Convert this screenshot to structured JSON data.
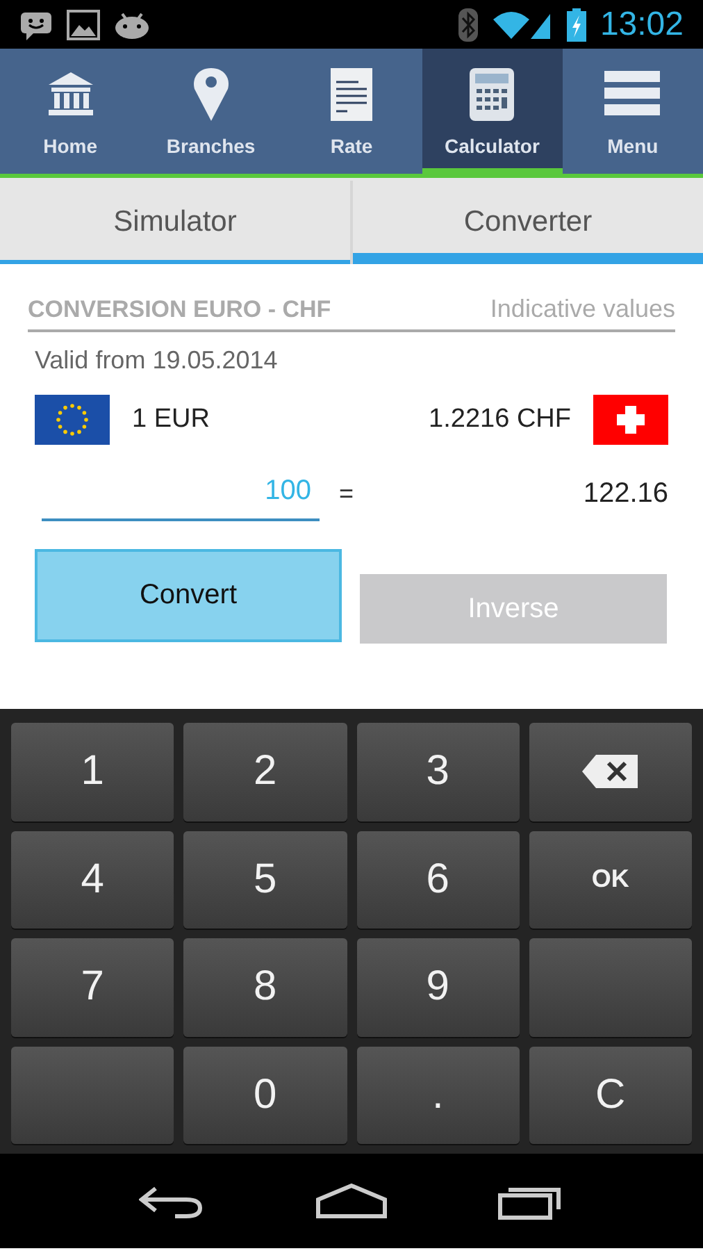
{
  "status_bar": {
    "time": "13:02"
  },
  "nav": [
    {
      "label": "Home",
      "kind": "bank",
      "selected": false
    },
    {
      "label": "Branches",
      "kind": "pin",
      "selected": false
    },
    {
      "label": "Rate",
      "kind": "note",
      "selected": false
    },
    {
      "label": "Calculator",
      "kind": "calculator",
      "selected": true
    },
    {
      "label": "Menu",
      "kind": "menu",
      "selected": false
    }
  ],
  "tabs": [
    {
      "label": "Simulator",
      "selected": false
    },
    {
      "label": "Converter",
      "selected": true
    }
  ],
  "converter": {
    "title": "CONVERSION EURO - CHF",
    "note": "Indicative values",
    "valid": "Valid from 19.05.2014",
    "from": {
      "kind": "eu",
      "text": "1 EUR"
    },
    "to": {
      "kind": "ch",
      "text": "1.2216 CHF"
    },
    "amount": "100",
    "equals": "=",
    "result": "122.16",
    "buttons": [
      {
        "label": "Convert",
        "disabled": false
      },
      {
        "label": "Inverse",
        "disabled": true
      }
    ]
  },
  "keypad": [
    {
      "kind": "text",
      "label": "1"
    },
    {
      "kind": "text",
      "label": "2"
    },
    {
      "kind": "text",
      "label": "3"
    },
    {
      "kind": "backspace"
    },
    {
      "kind": "text",
      "label": "4"
    },
    {
      "kind": "text",
      "label": "5"
    },
    {
      "kind": "text",
      "label": "6"
    },
    {
      "kind": "small",
      "label": "OK"
    },
    {
      "kind": "text",
      "label": "7"
    },
    {
      "kind": "text",
      "label": "8"
    },
    {
      "kind": "text",
      "label": "9"
    },
    {
      "kind": "blank"
    },
    {
      "kind": "blank"
    },
    {
      "kind": "text",
      "label": "0"
    },
    {
      "kind": "text",
      "label": "."
    },
    {
      "kind": "text",
      "label": "C"
    }
  ]
}
